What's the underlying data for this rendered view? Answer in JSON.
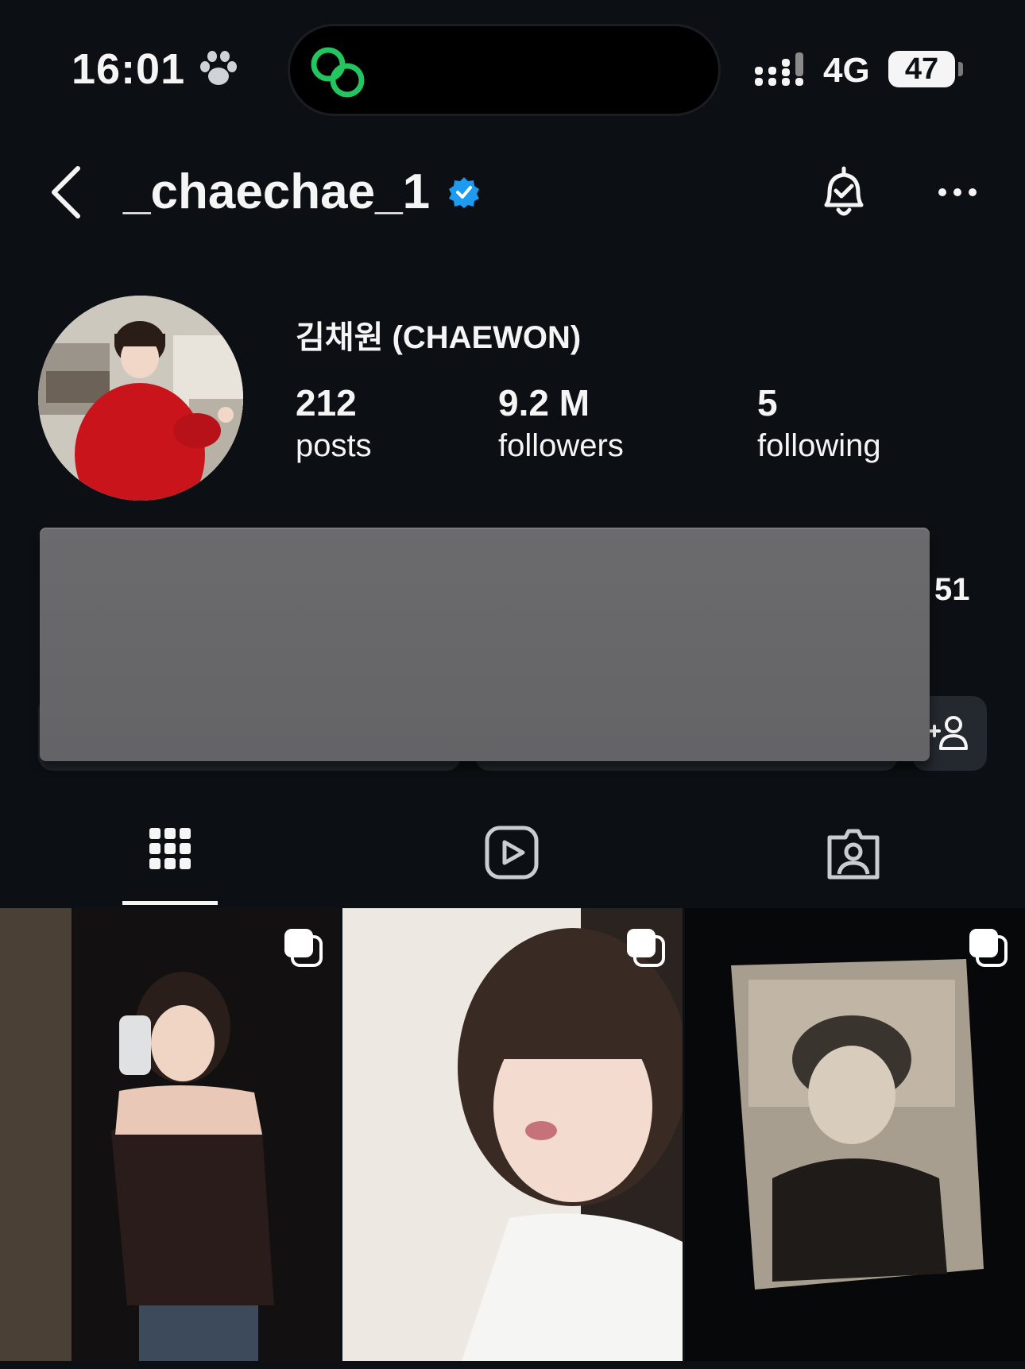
{
  "status_bar": {
    "time": "16:01",
    "network": "4G",
    "battery": "47",
    "icons": [
      "paw-icon",
      "link-app-icon",
      "signal-icon"
    ]
  },
  "header": {
    "username": "_chaechae_1",
    "icons": [
      "back-arrow-icon",
      "verified-badge-icon",
      "bell-check-icon",
      "more-icon"
    ]
  },
  "profile": {
    "full_name": "김채원 (CHAEWON)",
    "stats": [
      {
        "value": "212",
        "label": "posts"
      },
      {
        "value": "9.2 M",
        "label": "followers"
      },
      {
        "value": "5",
        "label": "following"
      }
    ],
    "side_count": "51"
  },
  "tabs": [
    {
      "icon": "grid-icon",
      "active": true
    },
    {
      "icon": "reels-icon",
      "active": false
    },
    {
      "icon": "tagged-icon",
      "active": false
    }
  ],
  "posts": [
    {
      "icon": "multiple-photos-icon"
    },
    {
      "icon": "multiple-photos-icon"
    },
    {
      "icon": "multiple-photos-icon"
    }
  ],
  "colors": {
    "background": "#0c1014",
    "verified_blue": "#1d9bf0",
    "button_bg": "#24292f",
    "link_green": "#22c55e"
  }
}
